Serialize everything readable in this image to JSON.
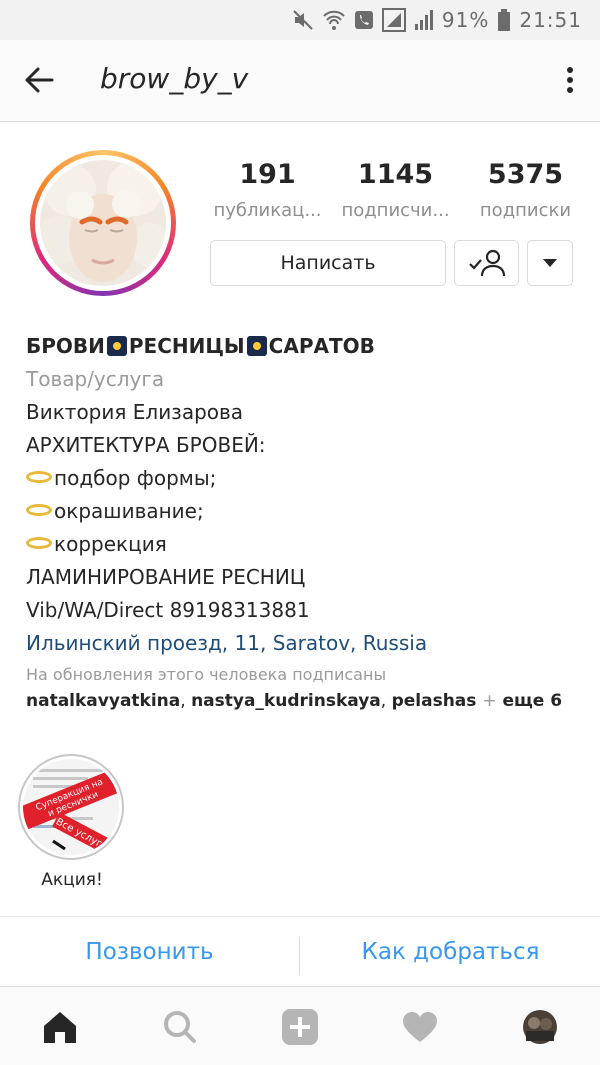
{
  "status_bar": {
    "battery": "91%",
    "time": "21:51"
  },
  "header": {
    "username": "brow_by_v"
  },
  "stats": [
    {
      "value": "191",
      "label": "публикац..."
    },
    {
      "value": "1145",
      "label": "подписчи..."
    },
    {
      "value": "5375",
      "label": "подписки"
    }
  ],
  "buttons": {
    "message": "Написать"
  },
  "bio": {
    "name_parts": [
      "БРОВИ",
      "РЕСНИЦЫ",
      "САРАТОВ"
    ],
    "category": "Товар/услуга",
    "lines": [
      "Виктория Елизарова",
      "АРХИТЕКТУРА БРОВЕЙ:"
    ],
    "list_items": [
      "подбор формы;",
      "окрашивание;",
      "коррекция"
    ],
    "lines2": [
      "ЛАМИНИРОВАНИЕ РЕСНИЦ",
      "Vib/WA/Direct 89198313881"
    ],
    "location": "Ильинский проезд, 11, Saratov, Russia",
    "followed_by_label": "На обновления этого человека подписаны",
    "followed_by": [
      "natalkavyatkina",
      "nastya_kudrinskaya",
      "pelashas"
    ],
    "followed_by_more": "еще 6"
  },
  "highlight": {
    "label": "Акция!",
    "banner_top": "Суперакция на",
    "banner_mid": "и реснички",
    "banner_bottom": "Все услуги"
  },
  "actions": {
    "call": "Позвонить",
    "directions": "Как добраться"
  },
  "colors": {
    "accent": "#3897f0",
    "link": "#1f4d7a",
    "muted": "#8e8e8e",
    "highlight_banner": "#e0202a"
  }
}
